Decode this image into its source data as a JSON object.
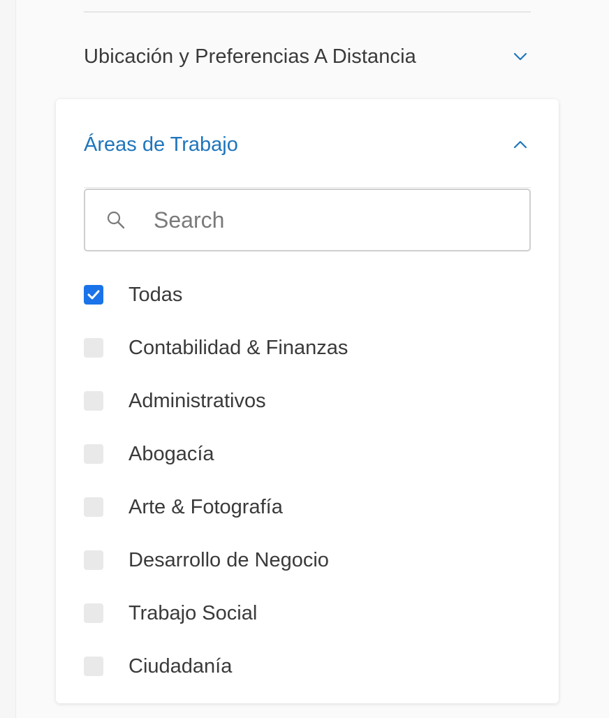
{
  "location_section": {
    "title": "Ubicación y Preferencias A Distancia",
    "expanded": false,
    "chevron_icon": "chevron-down-icon"
  },
  "work_areas": {
    "title": "Áreas de Trabajo",
    "expanded": true,
    "chevron_icon": "chevron-up-icon",
    "search": {
      "placeholder": "Search",
      "value": ""
    },
    "options": [
      {
        "label": "Todas",
        "checked": true
      },
      {
        "label": "Contabilidad & Finanzas",
        "checked": false
      },
      {
        "label": "Administrativos",
        "checked": false
      },
      {
        "label": "Abogacía",
        "checked": false
      },
      {
        "label": "Arte & Fotografía",
        "checked": false
      },
      {
        "label": "Desarrollo de Negocio",
        "checked": false
      },
      {
        "label": "Trabajo Social",
        "checked": false
      },
      {
        "label": "Ciudadanía",
        "checked": false
      }
    ]
  },
  "colors": {
    "accent": "#1f75bb",
    "checkbox_checked": "#1a73e8",
    "checkbox_unchecked": "#e9e9e9",
    "text": "#3a3a3a"
  }
}
